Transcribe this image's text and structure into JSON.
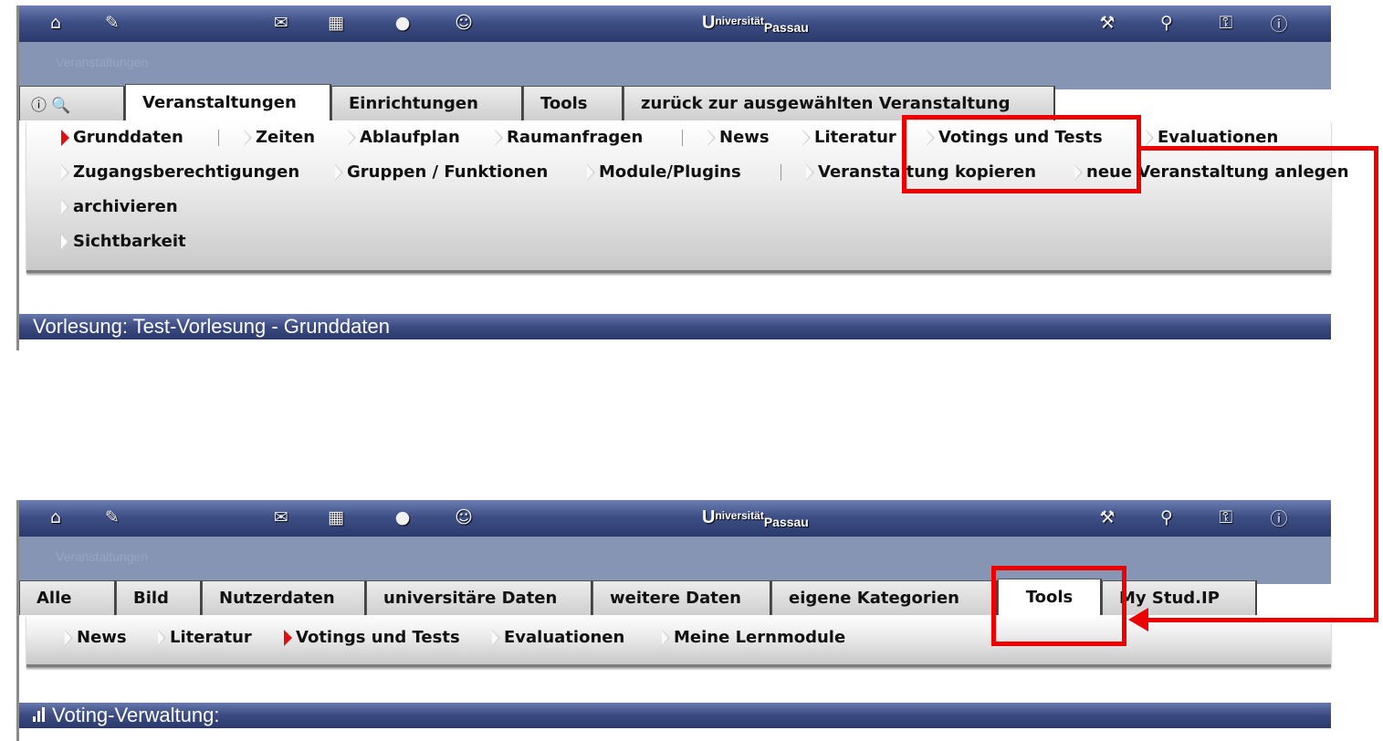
{
  "top": {
    "brand": {
      "cap1": "U",
      "part1": "niversität",
      "cap2": "P",
      "part2": "assau"
    },
    "ghost_text": "Veranstaltungen",
    "tabs": [
      {
        "label": "ⓘ 🔍"
      },
      {
        "label": "Veranstaltungen"
      },
      {
        "label": "Einrichtungen"
      },
      {
        "label": "Tools"
      },
      {
        "label": "zurück zur ausgewählten Veranstaltung"
      }
    ],
    "submenu": {
      "row1": [
        "Grunddaten",
        "Zeiten",
        "Ablaufplan",
        "Raumanfragen",
        "News",
        "Literatur",
        "Votings und Tests",
        "Evaluationen"
      ],
      "row2": [
        "Zugangsberechtigungen",
        "Gruppen / Funktionen",
        "Module/Plugins",
        "Veranstaltung kopieren",
        "neue Veranstaltung anlegen"
      ],
      "row3": [
        "archivieren"
      ],
      "row4": [
        "Sichtbarkeit"
      ]
    },
    "title": "Vorlesung: Test-Vorlesung - Grunddaten"
  },
  "bottom": {
    "brand": {
      "cap1": "U",
      "part1": "niversität",
      "cap2": "P",
      "part2": "assau"
    },
    "ghost_text": "Veranstaltungen",
    "tabs": [
      {
        "label": "Alle"
      },
      {
        "label": "Bild"
      },
      {
        "label": "Nutzerdaten"
      },
      {
        "label": "universitäre Daten"
      },
      {
        "label": "weitere Daten"
      },
      {
        "label": "eigene Kategorien"
      },
      {
        "label": "Tools"
      },
      {
        "label": "My Stud.IP"
      }
    ],
    "submenu": [
      "News",
      "Literatur",
      "Votings und Tests",
      "Evaluationen",
      "Meine Lernmodule"
    ],
    "title": "Voting-Verwaltung:"
  },
  "icons": {
    "left": [
      "home-icon",
      "edit-icon",
      "mail-icon",
      "calendar-icon",
      "chat-icon",
      "community-icon"
    ],
    "right": [
      "tools-icon",
      "search-icon",
      "key-icon",
      "info-icon"
    ]
  },
  "colors": {
    "highlight": "#ee0000",
    "header": "#3e4f86",
    "selected_marker": "#e01010"
  }
}
